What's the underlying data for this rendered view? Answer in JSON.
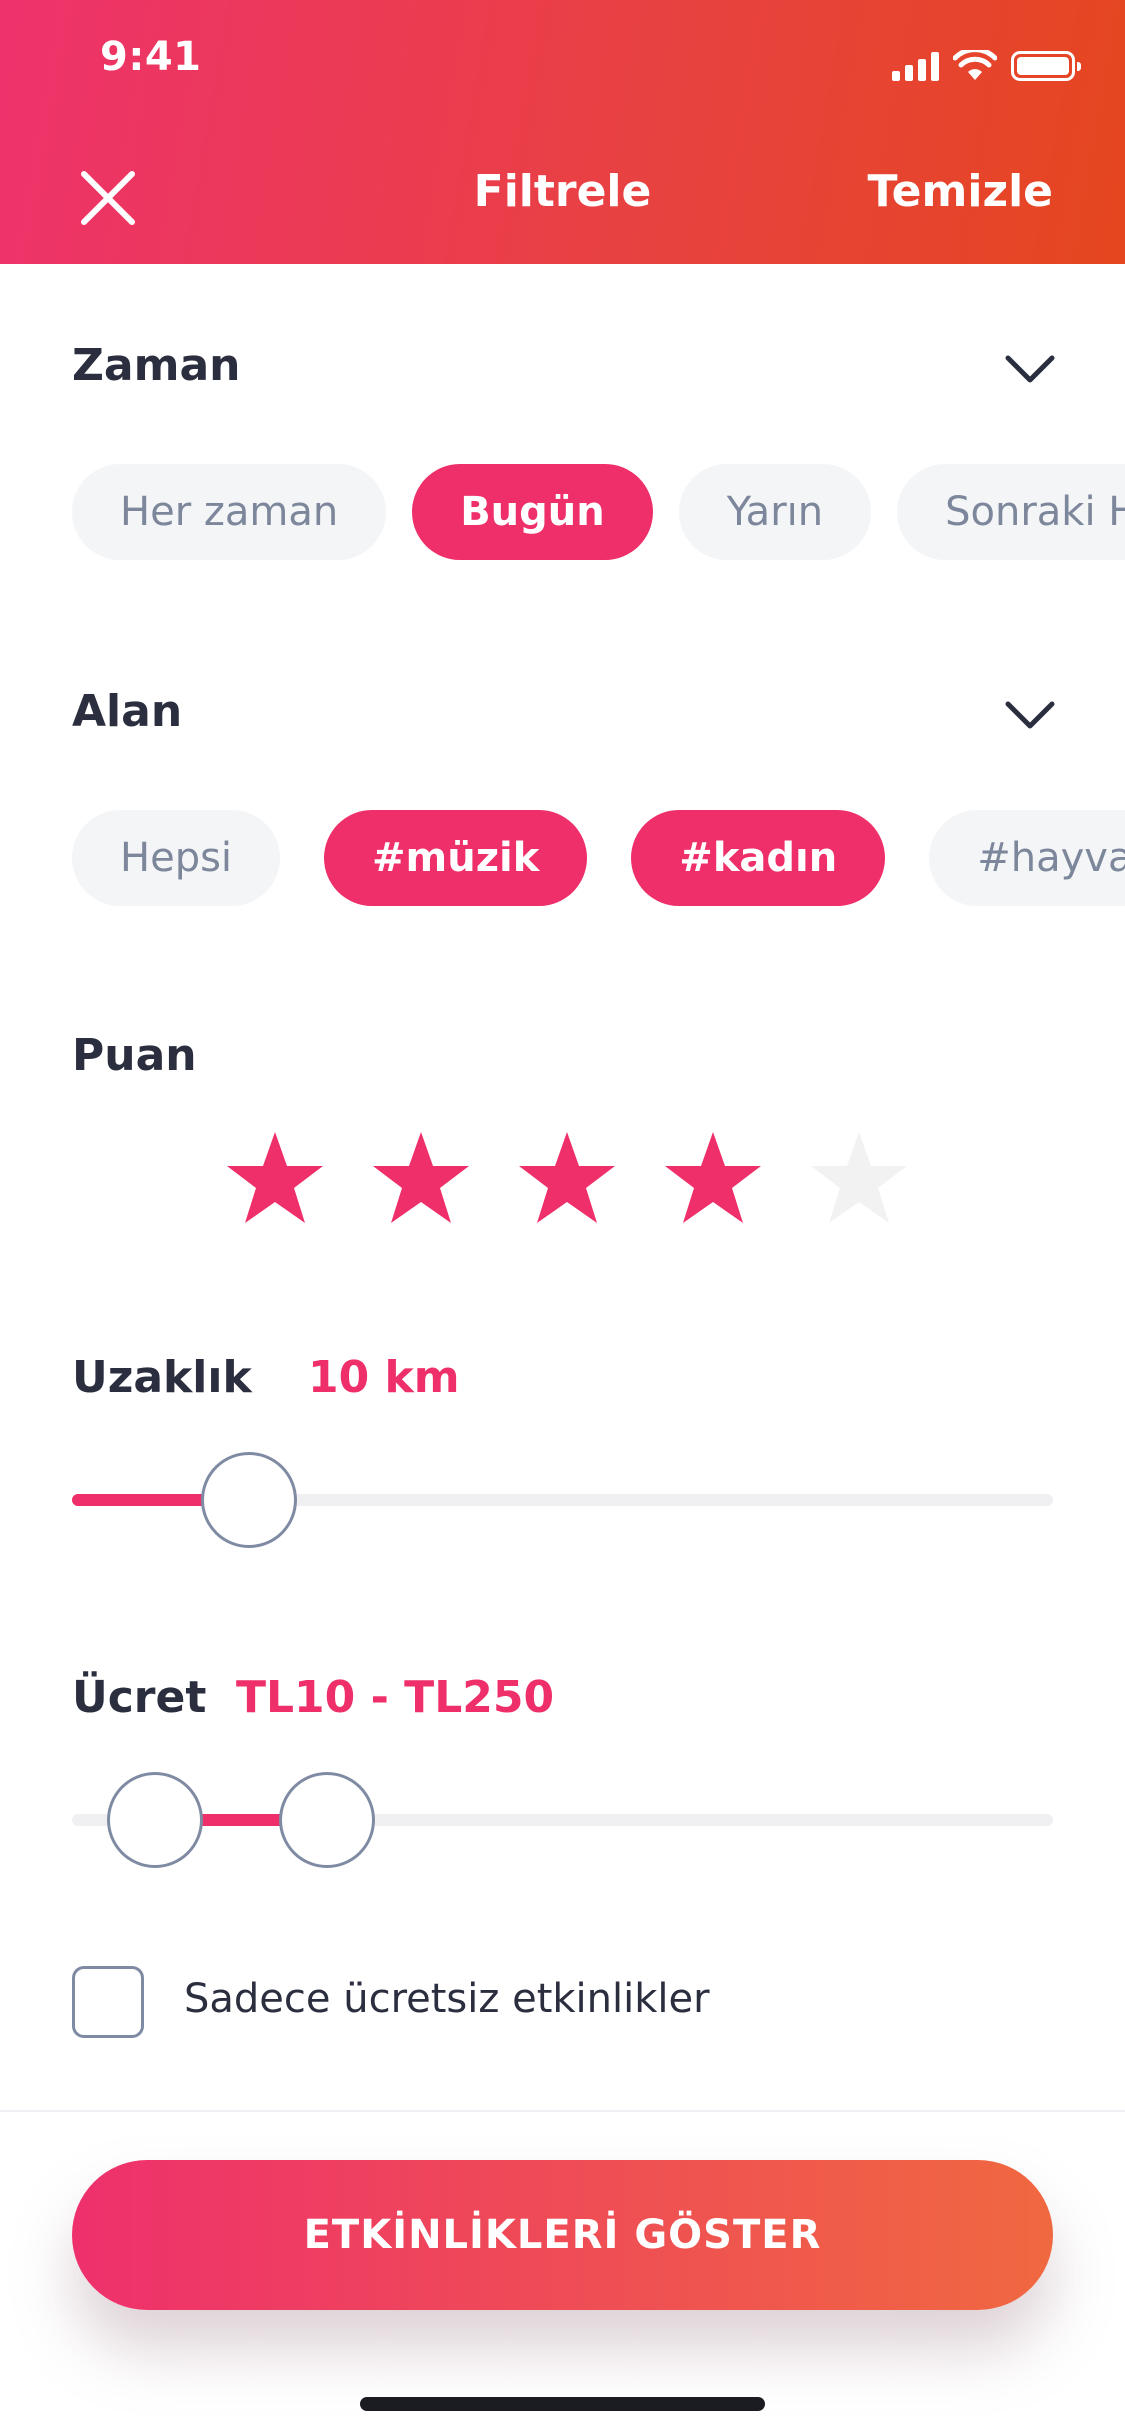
{
  "status_bar": {
    "time": "9:41"
  },
  "header": {
    "title": "Filtrele",
    "clear_label": "Temizle"
  },
  "time_section": {
    "title": "Zaman",
    "chips": [
      {
        "label": "Her zaman",
        "selected": false
      },
      {
        "label": "Bugün",
        "selected": true
      },
      {
        "label": "Yarın",
        "selected": false
      },
      {
        "label": "Sonraki H",
        "selected": false
      }
    ]
  },
  "area_section": {
    "title": "Alan",
    "chips": [
      {
        "label": "Hepsi",
        "selected": false
      },
      {
        "label": "#müzik",
        "selected": true
      },
      {
        "label": "#kadın",
        "selected": true
      },
      {
        "label": "#hayvan",
        "selected": false
      }
    ]
  },
  "rating_section": {
    "title": "Puan",
    "rating": 4,
    "max": 5
  },
  "distance_section": {
    "title": "Uzaklık",
    "value": "10 km",
    "slider_fraction": 0.18
  },
  "price_section": {
    "title": "Ücret",
    "value": "TL10 - TL250",
    "range_fraction": [
      0.085,
      0.26
    ]
  },
  "free_only": {
    "label": "Sadece ücretsiz etkinlikler",
    "checked": false
  },
  "cta": {
    "label": "ETKİNLİKLERİ GÖSTER"
  },
  "colors": {
    "accent": "#ee2f69",
    "header_start": "#ee326c",
    "header_end": "#e5461f",
    "chip_bg": "#f4f5f7",
    "chip_text": "#7d879b",
    "star_inactive": "#f2f2f3"
  }
}
